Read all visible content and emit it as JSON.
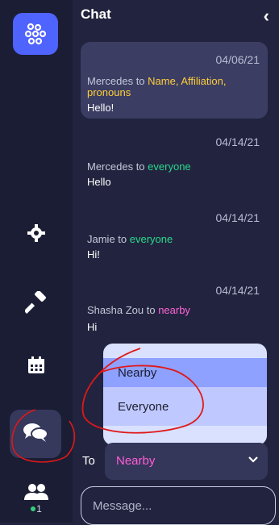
{
  "header": {
    "title": "Chat"
  },
  "messages": [
    {
      "date": "04/06/21",
      "sender": "Mercedes to",
      "recipient": "Name, Affiliation, pronouns",
      "recipient_color": "#ffcf3a",
      "text": "Hello!"
    },
    {
      "date": "04/14/21",
      "sender": "Mercedes to",
      "recipient": "everyone",
      "recipient_color": "#29d98a",
      "text": "Hello"
    },
    {
      "date": "04/14/21",
      "sender": "Jamie to",
      "recipient": "everyone",
      "recipient_color": "#29d98a",
      "text": "Hi!"
    },
    {
      "date": "04/14/21",
      "sender": "Shasha Zou to",
      "recipient": "nearby",
      "recipient_color": "#ff63d6",
      "text": "Hi"
    }
  ],
  "dropdown": {
    "options": [
      "Nearby",
      "Everyone"
    ],
    "selected": "Nearby"
  },
  "to": {
    "label": "To",
    "value": "Nearby"
  },
  "input": {
    "placeholder": "Message..."
  },
  "sidebar": {
    "icons": [
      "app-logo-icon",
      "gear-icon",
      "hammer-icon",
      "calendar-icon",
      "chat-bubbles-icon",
      "people-icon"
    ],
    "online_count": "1"
  }
}
